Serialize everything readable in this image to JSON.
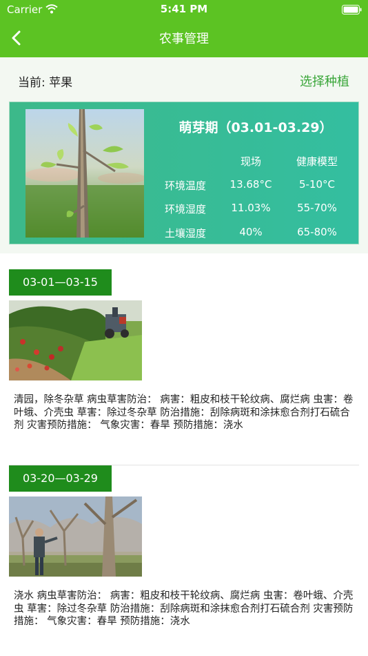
{
  "status_bar": {
    "carrier": "Carrier",
    "time": "5:41 PM"
  },
  "nav": {
    "title": "农事管理"
  },
  "current": {
    "label": "当前: 苹果",
    "choose_label": "选择种植"
  },
  "stage_card": {
    "title": "萌芽期（03.01-03.29）",
    "header": {
      "metric": "",
      "actual": "现场",
      "model": "健康模型"
    },
    "rows": [
      {
        "metric": "环境温度",
        "actual": "13.68°C",
        "model": "5-10°C"
      },
      {
        "metric": "环境湿度",
        "actual": "11.03%",
        "model": "55-70%"
      },
      {
        "metric": "土壤湿度",
        "actual": "40%",
        "model": "65-80%"
      }
    ]
  },
  "periods": [
    {
      "date_range": "03-01—03-15",
      "photo_icon": "apple-orchard-tractor-photo",
      "description": "清园，除冬杂草 病虫草害防治： 病害：粗皮和枝干轮纹病、腐烂病 虫害：卷叶蛾、介壳虫 草害：除过冬杂草 防治措施：刮除病斑和涂抹愈合剂打石硫合剂 灾害预防措施： 气象灾害：春旱 预防措施：浇水"
    },
    {
      "date_range": "03-20—03-29",
      "photo_icon": "orchard-pruning-worker-photo",
      "description": "浇水 病虫草害防治： 病害：粗皮和枝干轮纹病、腐烂病 虫害：卷叶蛾、介壳虫 草害：除过冬杂草 防治措施：刮除病斑和涂抹愈合剂打石硫合剂 灾害预防措施： 气象灾害：春旱 预防措施：浇水"
    }
  ],
  "colors": {
    "nav_green": "#5cc323",
    "badge_green": "#1f8c1c",
    "card_teal": "#3cb98a",
    "link_green": "#3aa63a"
  }
}
